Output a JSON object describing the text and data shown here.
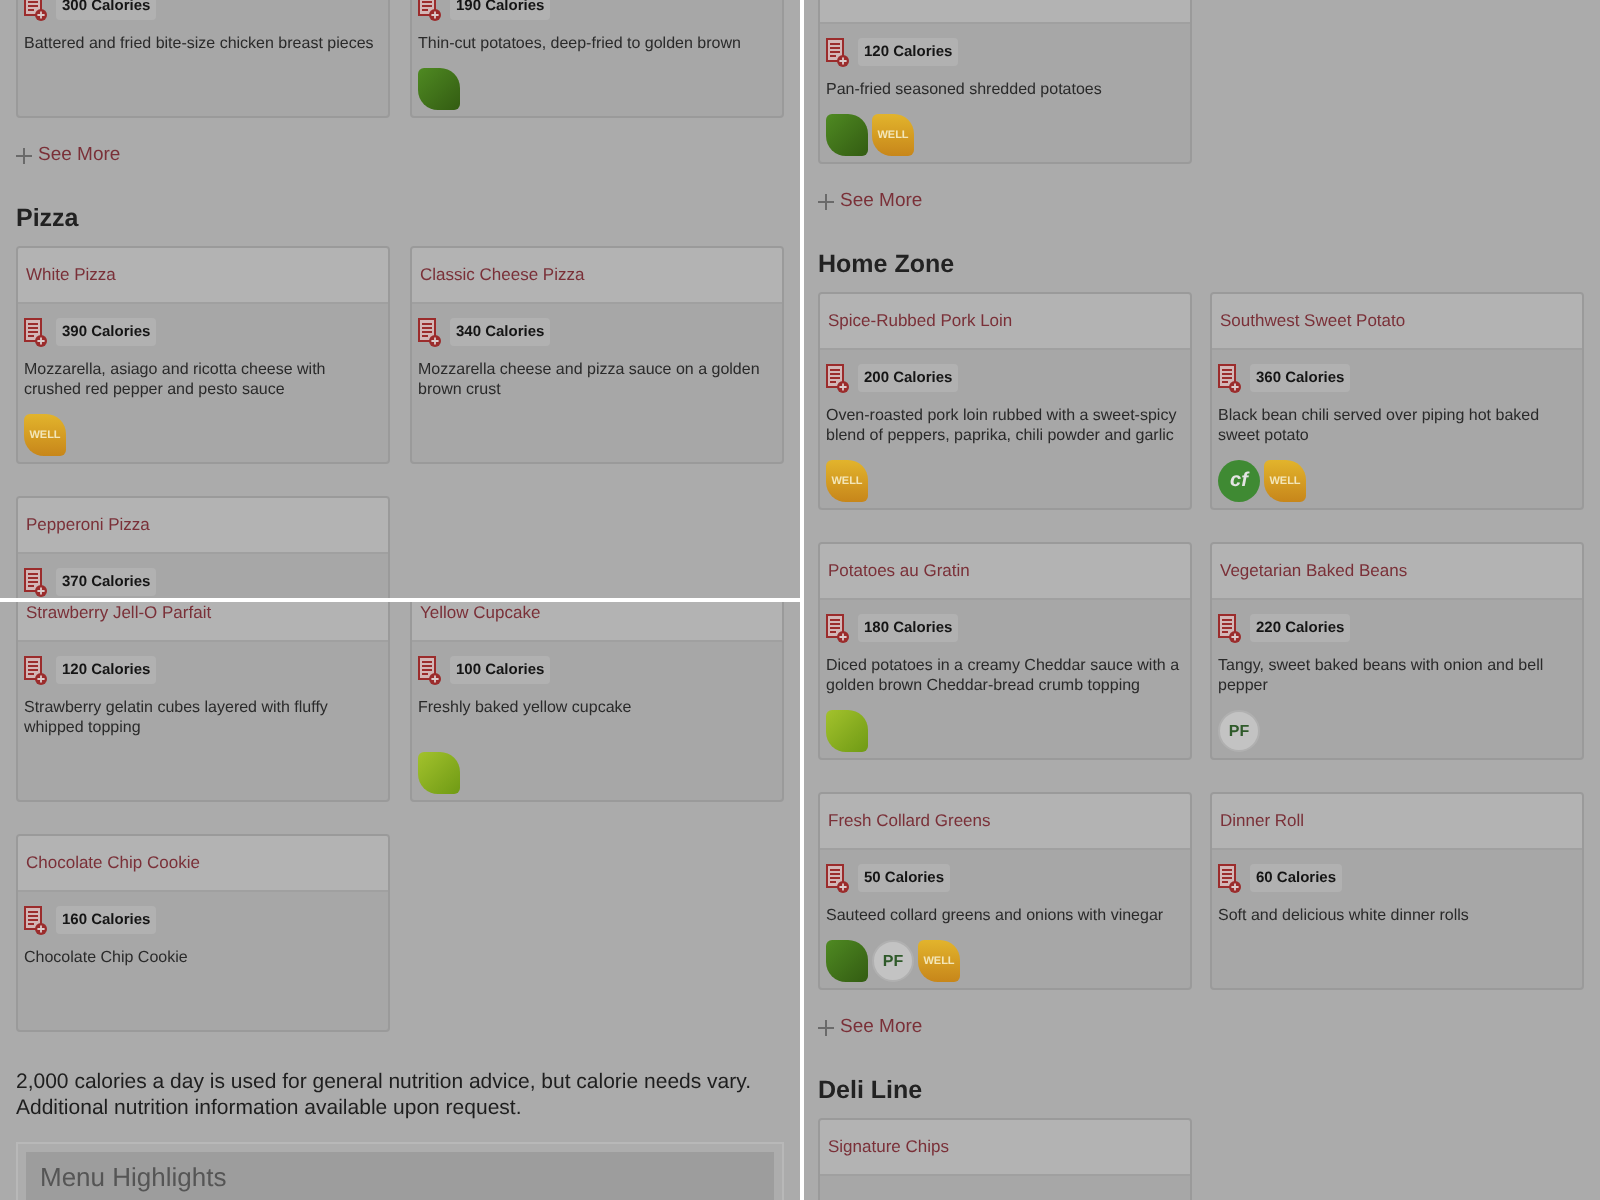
{
  "panels": [
    {
      "sections": [
        {
          "cards": [
            {
              "calories": "300 Calories",
              "description": "Battered and fried bite-size chicken breast pieces"
            },
            {
              "calories": "190 Calories",
              "description": "Thin-cut potatoes, deep-fried to golden brown",
              "badges": [
                {
                  "kind": "vegan"
                }
              ]
            }
          ],
          "see_more": "See More"
        },
        {
          "heading": "Pizza",
          "cards": [
            {
              "title": "White Pizza",
              "calories": "390 Calories",
              "description": "Mozzarella, asiago and ricotta cheese with crushed red pepper and pesto sauce",
              "badges": [
                {
                  "kind": "well",
                  "label": "WELL"
                }
              ]
            },
            {
              "title": "Classic Cheese Pizza",
              "calories": "340 Calories",
              "description": "Mozzarella cheese and pizza sauce on a golden brown crust"
            },
            {
              "title": "Pepperoni Pizza",
              "calories": "370 Calories"
            }
          ]
        }
      ]
    },
    {
      "sections": [
        {
          "cards": [
            {
              "title": "Strawberry Jell-O Parfait",
              "calories": "120 Calories",
              "description": "Strawberry gelatin cubes layered with fluffy whipped topping"
            },
            {
              "title": "Yellow Cupcake",
              "calories": "100 Calories",
              "description": "Freshly baked yellow cupcake",
              "badges": [
                {
                  "kind": "vegetarian"
                }
              ]
            },
            {
              "title": "Chocolate Chip Cookie",
              "calories": "160 Calories",
              "description": "Chocolate Chip Cookie"
            }
          ]
        }
      ],
      "note": "2,000 calories a day is used for general nutrition advice, but calorie needs vary. Additional nutrition information available upon request.",
      "highlights": {
        "title": "Menu Highlights"
      }
    },
    {
      "sections": [
        {
          "cards": [
            {
              "calories": "120 Calories",
              "description": "Pan-fried seasoned shredded potatoes",
              "badges": [
                {
                  "kind": "vegan"
                },
                {
                  "kind": "well",
                  "label": "WELL"
                }
              ]
            }
          ],
          "see_more": "See More"
        },
        {
          "heading": "Home Zone",
          "cards": [
            {
              "title": "Spice-Rubbed Pork Loin",
              "calories": "200 Calories",
              "description": "Oven-roasted pork loin rubbed with a sweet-spicy blend of peppers, paprika, chili powder and garlic",
              "badges": [
                {
                  "kind": "well",
                  "label": "WELL"
                }
              ]
            },
            {
              "title": "Southwest Sweet Potato",
              "calories": "360 Calories",
              "description": "Black bean chili served over piping hot baked sweet potato",
              "badges": [
                {
                  "kind": "cf",
                  "label": "cf"
                },
                {
                  "kind": "well",
                  "label": "WELL"
                }
              ]
            },
            {
              "title": "Potatoes au Gratin",
              "calories": "180 Calories",
              "description": "Diced potatoes in a creamy Cheddar sauce with a golden brown Cheddar-bread crumb topping",
              "badges": [
                {
                  "kind": "vegetarian"
                }
              ]
            },
            {
              "title": "Vegetarian Baked Beans",
              "calories": "220 Calories",
              "description": "Tangy, sweet baked beans with onion and bell pepper",
              "badges": [
                {
                  "kind": "pf",
                  "label": "PF"
                }
              ]
            },
            {
              "title": "Fresh Collard Greens",
              "calories": "50 Calories",
              "description": "Sauteed collard greens and onions with vinegar",
              "badges": [
                {
                  "kind": "vegan"
                },
                {
                  "kind": "pf",
                  "label": "PF"
                },
                {
                  "kind": "well",
                  "label": "WELL"
                }
              ]
            },
            {
              "title": "Dinner Roll",
              "calories": "60 Calories",
              "description": "Soft and delicious white dinner rolls"
            }
          ],
          "see_more": "See More"
        },
        {
          "heading": "Deli Line",
          "cards": [
            {
              "title": "Signature Chips"
            }
          ]
        }
      ]
    }
  ]
}
